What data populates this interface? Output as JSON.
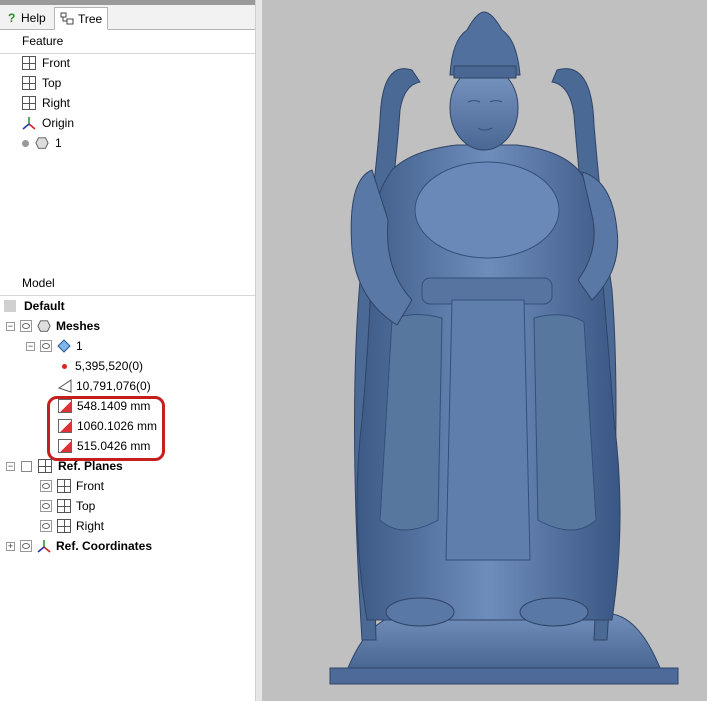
{
  "tabs": {
    "help": "Help",
    "tree": "Tree"
  },
  "feature": {
    "title": "Feature",
    "items": [
      {
        "label": "Front",
        "icon": "plane-icon"
      },
      {
        "label": "Top",
        "icon": "plane-icon"
      },
      {
        "label": "Right",
        "icon": "plane-icon"
      },
      {
        "label": "Origin",
        "icon": "origin-axes-icon"
      },
      {
        "label": "1",
        "icon": "mesh-icon"
      }
    ]
  },
  "model": {
    "title": "Model",
    "default": "Default",
    "meshes": "Meshes",
    "mesh_name": "1",
    "vertices": "5,395,520(0)",
    "faces": "10,791,076(0)",
    "dims": [
      "548.1409 mm",
      "1060.1026 mm",
      "515.0426 mm"
    ],
    "ref_planes": "Ref. Planes",
    "ref_plane_items": [
      "Front",
      "Top",
      "Right"
    ],
    "ref_coordinates": "Ref. Coordinates"
  },
  "colors": {
    "model": "#5573a1",
    "viewport": "#c0c0c0",
    "highlight": "#c41e1e"
  }
}
